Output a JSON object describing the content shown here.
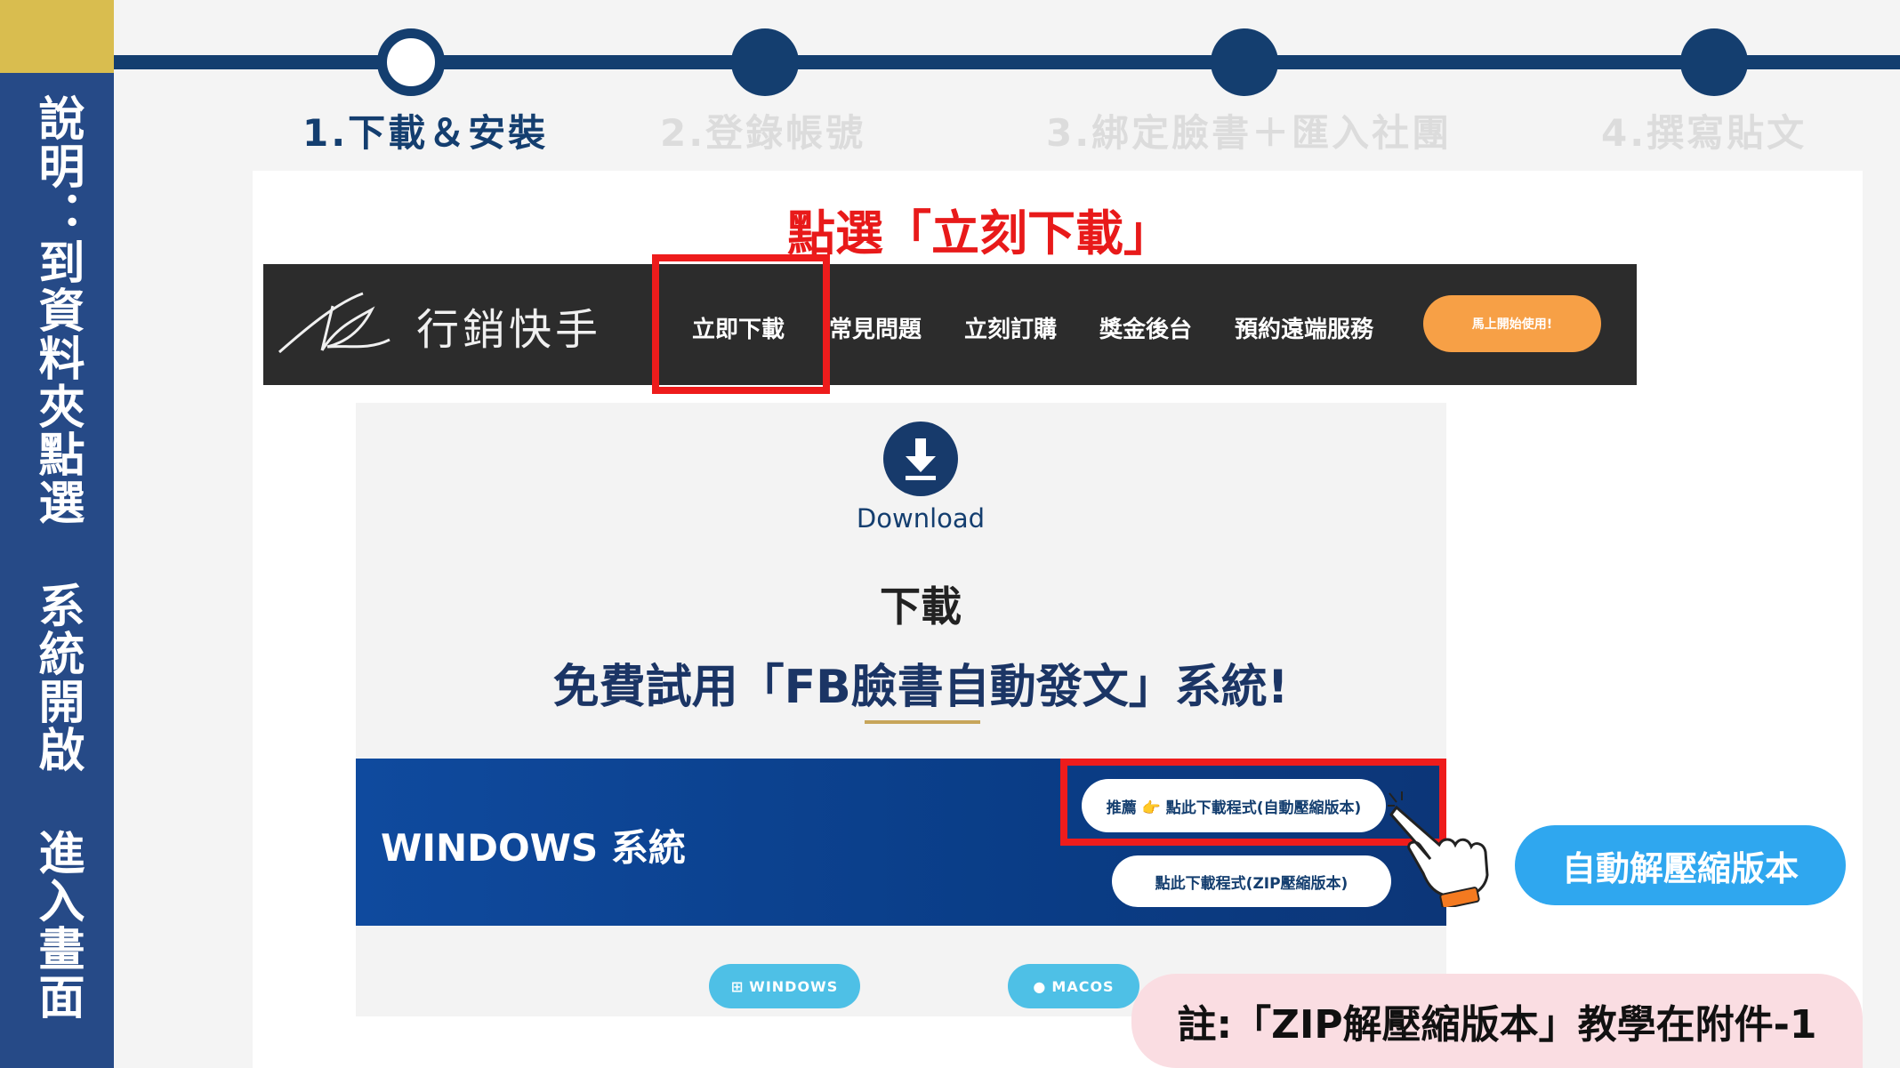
{
  "sidebar": {
    "title": "說明：到資料夾點選 系統開啟 進入畫面"
  },
  "steps": [
    {
      "label": "1.下載＆安裝",
      "active": true
    },
    {
      "label": "2.登錄帳號",
      "active": false
    },
    {
      "label": "3.綁定臉書＋匯入社團",
      "active": false
    },
    {
      "label": "4.撰寫貼文",
      "active": false
    }
  ],
  "headline": "點選「立刻下載」",
  "site": {
    "logo_text": "行銷快手",
    "nav": [
      "立即下載",
      "常見問題",
      "立刻訂購",
      "獎金後台",
      "預約遠端服務"
    ],
    "cta": "馬上開始使用!"
  },
  "download": {
    "icon": "download-icon",
    "label": "Download",
    "title": "下載",
    "subtitle": "免費試用「FB臉書自動發文」系統!",
    "windows_title": "WINDOWS 系統",
    "btn_auto": "推薦 👉 點此下載程式(自動壓縮版本)",
    "btn_zip": "點此下載程式(ZIP壓縮版本)",
    "os_windows": "WINDOWS",
    "os_mac": "MACOS"
  },
  "callout": "自動解壓縮版本",
  "note": "註:「ZIP解壓縮版本」教學在附件-1",
  "colors": {
    "navy": "#143e6f",
    "sidebar": "#264a87",
    "gold": "#d9bd4f",
    "highlight_red": "#ee1c1c",
    "cta_orange": "#f7a046",
    "callout_blue": "#2fa7ef",
    "note_pink": "#fadde2"
  }
}
